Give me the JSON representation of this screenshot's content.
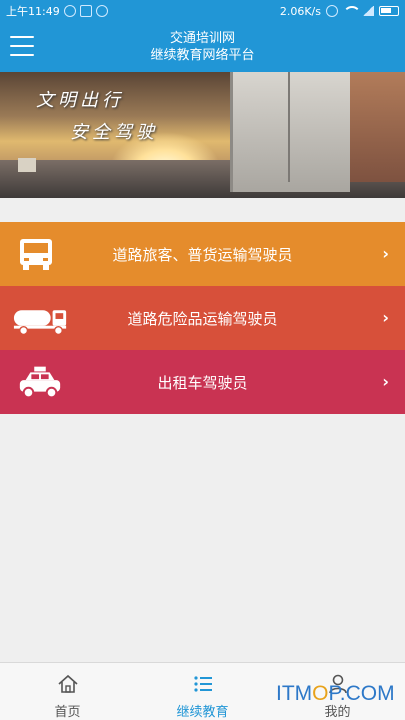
{
  "status_bar": {
    "time": "上午11:49",
    "speed": "2.06K/s"
  },
  "header": {
    "title_line1": "交通培训网",
    "title_line2": "继续教育网络平台"
  },
  "banner": {
    "slogan_line1": "文明出行",
    "slogan_line2": "安全驾驶"
  },
  "menu": [
    {
      "label": "道路旅客、普货运输驾驶员",
      "icon": "bus-icon",
      "color": "#e58c2c"
    },
    {
      "label": "道路危险品运输驾驶员",
      "icon": "tanker-truck-icon",
      "color": "#d7503a"
    },
    {
      "label": "出租车驾驶员",
      "icon": "taxi-icon",
      "color": "#c93352"
    }
  ],
  "bottom_nav": [
    {
      "label": "首页",
      "icon": "home-icon",
      "active": false
    },
    {
      "label": "继续教育",
      "icon": "list-icon",
      "active": true
    },
    {
      "label": "我的",
      "icon": "user-icon",
      "active": false
    }
  ],
  "watermark": {
    "part1": "ITM",
    "part2": "O",
    "part3": "P.COM"
  },
  "colors": {
    "primary": "#2196d6",
    "background": "#efefef"
  }
}
